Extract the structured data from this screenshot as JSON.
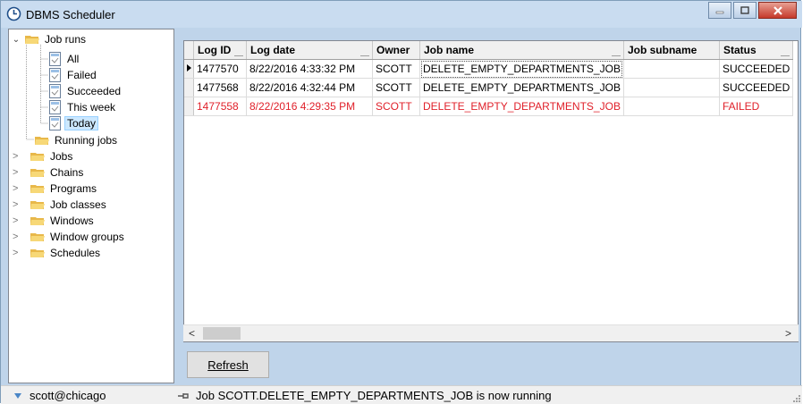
{
  "window": {
    "title": "DBMS Scheduler"
  },
  "tree": {
    "job_runs": {
      "label": "Job runs",
      "children": [
        "All",
        "Failed",
        "Succeeded",
        "This week",
        "Today"
      ]
    },
    "items": [
      "Running jobs",
      "Jobs",
      "Chains",
      "Programs",
      "Job classes",
      "Windows",
      "Window groups",
      "Schedules"
    ]
  },
  "grid": {
    "columns": [
      "Log ID",
      "Log date",
      "Owner",
      "Job name",
      "Job subname",
      "Status"
    ],
    "rows": [
      {
        "log_id": "1477570",
        "log_date": "8/22/2016 4:33:32 PM",
        "owner": "SCOTT",
        "job_name": "DELETE_EMPTY_DEPARTMENTS_JOB",
        "job_subname": "",
        "status": "SUCCEEDED"
      },
      {
        "log_id": "1477568",
        "log_date": "8/22/2016 4:32:44 PM",
        "owner": "SCOTT",
        "job_name": "DELETE_EMPTY_DEPARTMENTS_JOB",
        "job_subname": "",
        "status": "SUCCEEDED"
      },
      {
        "log_id": "1477558",
        "log_date": "8/22/2016 4:29:35 PM",
        "owner": "SCOTT",
        "job_name": "DELETE_EMPTY_DEPARTMENTS_JOB",
        "job_subname": "",
        "status": "FAILED"
      }
    ]
  },
  "buttons": {
    "refresh": "Refresh"
  },
  "status": {
    "connection": "scott@chicago",
    "message": "Job SCOTT.DELETE_EMPTY_DEPARTMENTS_JOB is now running"
  },
  "colors": {
    "failed_text": "#e0202a",
    "selection": "#cce8ff"
  }
}
